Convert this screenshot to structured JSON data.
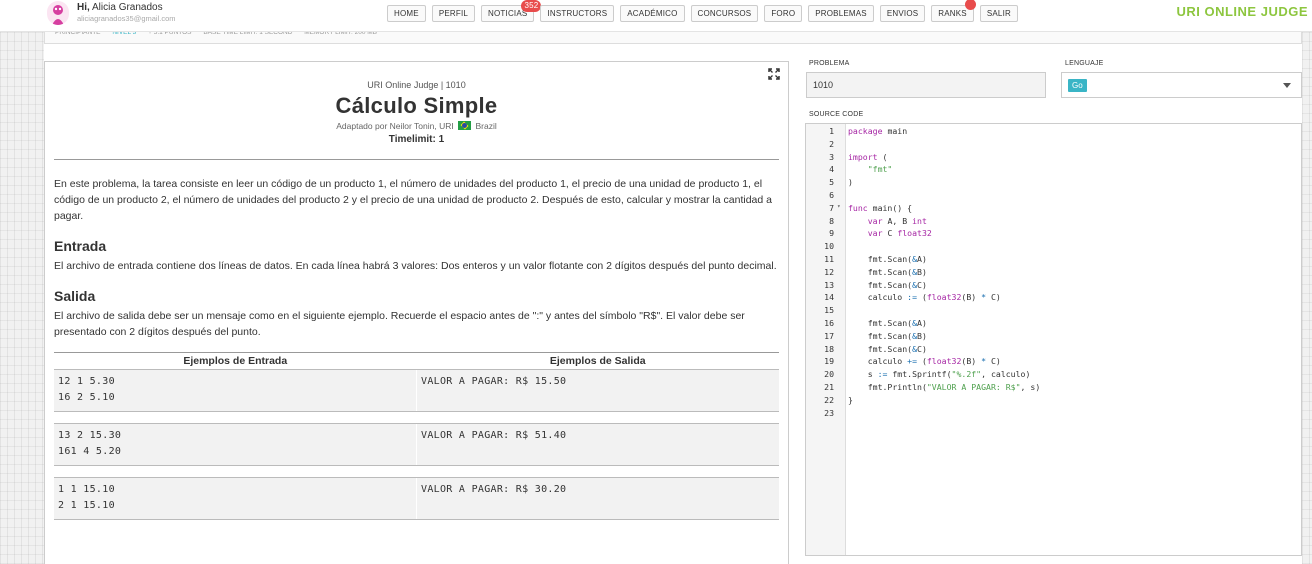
{
  "header": {
    "greeting_prefix": "Hi,",
    "user_name": "Alicia Granados",
    "user_email": "aliciagranados35@gmail.com",
    "nav": [
      {
        "label": "HOME"
      },
      {
        "label": "PERFIL"
      },
      {
        "label": "NOTICIAS",
        "badge": "352"
      },
      {
        "label": "INSTRUCTORS"
      },
      {
        "label": "ACADÉMICO"
      },
      {
        "label": "CONCURSOS"
      },
      {
        "label": "FORO"
      },
      {
        "label": "PROBLEMAS"
      },
      {
        "label": "ENVIOS"
      },
      {
        "label": "RANKS",
        "dot": true
      },
      {
        "label": "SALIR"
      }
    ],
    "brand": "URI ONLINE JUDGE",
    "brand_color": "#8dc63f"
  },
  "info_strip": {
    "category": "PRINCIPIANTE",
    "level": "NIVEL 3",
    "points": "+ 5.1 PUNTOS",
    "time_limit": "BASE TIME LIMIT: 1 SECOND",
    "memory_limit": "MEMORY LIMIT: 200 MB"
  },
  "problem": {
    "source": "URI Online Judge | 1010",
    "title": "Cálculo Simple",
    "author_prefix": "Adaptado por Neilor Tonin, URI",
    "country": "Brazil",
    "timelimit": "Timelimit: 1",
    "description": "En este problema, la tarea consiste en leer un código de un producto 1, el número de unidades del producto 1, el precio de una unidad de producto 1, el código de un producto 2, el número de unidades del producto 2 y el precio de una unidad de producto 2. Después de esto, calcular y mostrar la cantidad a pagar.",
    "input_heading": "Entrada",
    "input_text": "El archivo de entrada contiene dos líneas de datos. En cada línea habrá 3 valores: Dos enteros y un valor flotante con 2 dígitos después del punto decimal.",
    "output_heading": "Salida",
    "output_text": "El archivo de salida debe ser un mensaje como en el siguiente ejemplo. Recuerde el espacio antes de \":\" y antes del símbolo \"R$\". El valor debe ser presentado con 2 dígitos después del punto.",
    "examples_input_header": "Ejemplos de Entrada",
    "examples_output_header": "Ejemplos de Salida",
    "examples": [
      {
        "input": "12 1 5.30\n16 2 5.10",
        "output": "VALOR A PAGAR: R$ 15.50"
      },
      {
        "input": "13 2 15.30\n161 4 5.20",
        "output": "VALOR A PAGAR: R$ 51.40"
      },
      {
        "input": "1 1 15.10\n2 1 15.10",
        "output": "VALOR A PAGAR: R$ 30.20"
      }
    ]
  },
  "form": {
    "problem_label": "PROBLEMA",
    "problem_value": "1010",
    "language_label": "LENGUAJE",
    "language_value": "Go",
    "source_label": "SOURCE CODE",
    "accent": "#3ab5c6"
  },
  "code_lines": [
    "package main",
    "",
    "import (",
    "    \"fmt\"",
    ")",
    "",
    "func main() {",
    "    var A, B int",
    "    var C float32",
    "",
    "    fmt.Scan(&A)",
    "    fmt.Scan(&B)",
    "    fmt.Scan(&C)",
    "    calculo := (float32(B) * C)",
    "",
    "    fmt.Scan(&A)",
    "    fmt.Scan(&B)",
    "    fmt.Scan(&C)",
    "    calculo += (float32(B) * C)",
    "    s := fmt.Sprintf(\"%.2f\", calculo)",
    "    fmt.Println(\"VALOR A PAGAR: R$\", s)",
    "}",
    ""
  ]
}
